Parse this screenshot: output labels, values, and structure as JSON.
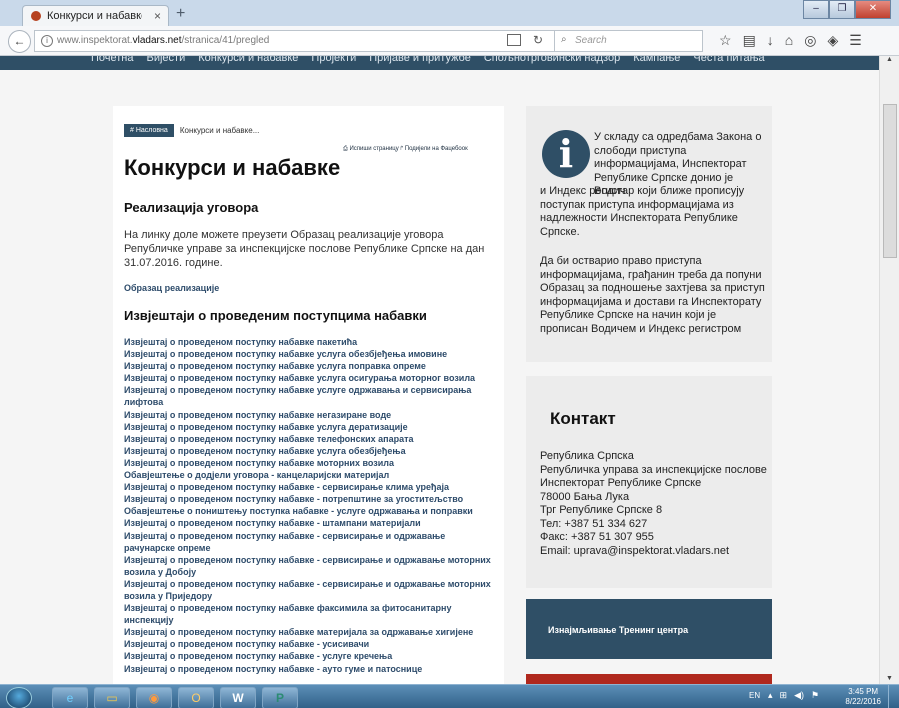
{
  "browser": {
    "tab_title": "Конкурси и набавке | Инс...",
    "tab_close": "×",
    "new_tab": "+",
    "url_prefix": "www.inspektorat.",
    "url_domain": "vladars.net",
    "url_path": "/stranica/41/pregled",
    "search_placeholder": "Search",
    "window_buttons": [
      "–",
      "❐",
      "✕"
    ],
    "toolbar_icons": [
      "star-icon",
      "bookmarks-icon",
      "download-icon",
      "home-icon",
      "pocket-icon",
      "shield-icon",
      "menu-icon"
    ],
    "icon_glyphs": {
      "back": "←",
      "info": "i",
      "reload": "↻",
      "search": "⌕"
    },
    "toolbar_glyphs": [
      "☆",
      "▤",
      "↓",
      "⌂",
      "◎",
      "◈",
      "☰"
    ]
  },
  "site_nav": [
    "Почетна",
    "Вијести",
    "Конкурси и набавке",
    "Пројекти",
    "Пријаве и притужбе",
    "Спољнотрговински надзор",
    "Кампање",
    "Честа питања"
  ],
  "breadcrumb": {
    "home": "# Насловна",
    "current": "Конкурси и набавке..."
  },
  "page_actions": "⎙ Испиши страницу   ↱ Подијели на Фацебоок",
  "main": {
    "title": "Конкурси и набавке",
    "section1_title": "Реализација уговора",
    "intro": "На линку доле можете преузети Образац реализације уговора Републичке управе за инспекцијске послове Републике Српске на дан 31.07.2016. године.",
    "doc_link": "Образац реализације",
    "section2_title": "Извјештаји о проведеним поступцима набавки",
    "reports": [
      "Извјештај о проведеном поступку набавке пакетића",
      "Извјештај о проведеном поступку набавке услуга обезбјеђења имовине",
      "Извјештај о проведеном поступку набавке услуга поправка опреме",
      "Извјештај о проведеном поступку набавке услуга осигурања моторног возила",
      "Извјештај о проведеном поступку набавке услуге одржавања и сервисирања лифтова",
      "Извјештај о проведеном поступку набавке негазиране воде",
      "Извјештај о проведеном поступку набавке услуга дератизације",
      "Извјештај о проведеном поступку набавке телефонских апарата",
      "Извјештај о проведеном поступку набавке услуга обезбјеђења",
      "Извјештај о проведеном поступку набавке моторних возила",
      "Обавјештење о додјели уговора - канцеларијски материјал",
      "Извјештај о проведеном поступку набавке - сервисирање клима уређаја",
      "Извјештај о проведеном поступку набавке - потрепштине за угоститељство",
      "Обавјештење о поништењу поступка набавке - услуге одржавања и поправки",
      "Извјештај о проведеном поступку набавке - штампани материјали",
      "Извјештај о проведеном поступку набавке - сервисирање и одржавање рачунарске опреме",
      "Извјештај о проведеном поступку набавке - сервисирање и одржавање моторних возила у Добоју",
      "Извјештај о проведеном поступку набавке - сервисирање и одржавање моторних возила у Приједору",
      "Извјештај о проведеном поступку набавке факсимила за фитосанитарну инспекцију",
      "Извјештај о проведеном поступку набавке материјала за одржавање хигијене",
      "Извјештај о проведеном поступку набавке - усисивачи",
      "Извјештај о проведеном поступку набавке - услуге кречења",
      "Извјештај о проведеном поступку набавке - ауто гуме и патоснице"
    ]
  },
  "sidebar": {
    "info_icon": "i",
    "info_text1": "У складу са одредбама Закона о слободи приступа информацијама, Инспекторат Републике Српске донио је Водич",
    "info_text2": "и Индекс регистар који ближе прописују поступак приступа информацијама из надлежности Инспектората Републике Српске.",
    "info_text3": "Да би остварио право приступа информацијама, грађанин треба да попуни Образац за подношење захтјева за приступ информацијама и достави га Инспекторату Републике Српске на начин који је прописан Водичем и Индекс регистром",
    "contact_title": "Контакт",
    "contact_lines": [
      "Република Српска",
      "Републичка управа за инспекцијске послове",
      "Инспекторат Републике Српске",
      "78000 Бања Лука",
      "Трг Републике Српске 8",
      "Тел: +387 51 334 627",
      "Факс: +387 51 307 955",
      "Email: uprava@inspektorat.vladars.net"
    ],
    "rent_text": "Изнајмљивање Тренинг центра"
  },
  "taskbar": {
    "lang": "EN",
    "time": "3:45 PM",
    "date": "8/22/2016",
    "tray_glyphs": [
      "▴",
      "⊞",
      "◀)",
      "⚑"
    ],
    "apps": [
      "ie-icon",
      "folder-icon",
      "firefox-icon",
      "outlook-icon",
      "word-icon",
      "publisher-icon"
    ],
    "app_glyphs": [
      "e",
      "▭",
      "◉",
      "O",
      "W",
      "P"
    ]
  }
}
